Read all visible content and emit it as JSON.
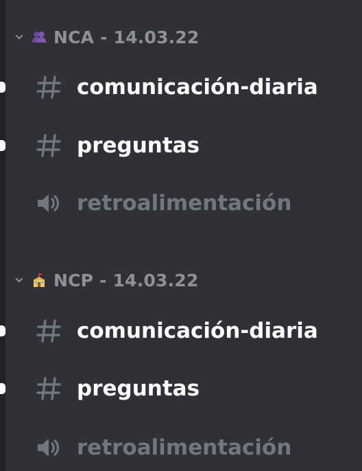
{
  "categories": [
    {
      "name": "NCA - 14.03.22",
      "emoji": "people-icon",
      "channels": [
        {
          "name": "comunicación-diaria",
          "type": "text",
          "unread": true
        },
        {
          "name": "preguntas",
          "type": "text",
          "unread": true
        },
        {
          "name": "retroalimentación",
          "type": "voice",
          "unread": false
        }
      ]
    },
    {
      "name": "NCP - 14.03.22",
      "emoji": "school-icon",
      "channels": [
        {
          "name": "comunicación-diaria",
          "type": "text",
          "unread": true
        },
        {
          "name": "preguntas",
          "type": "text",
          "unread": true
        },
        {
          "name": "retroalimentación",
          "type": "voice",
          "unread": false
        }
      ]
    }
  ],
  "colors": {
    "background": "#2f3136",
    "category_text": "#8e9297",
    "unread_text": "#ffffff",
    "muted_text": "#72767d",
    "icon_gray": "#72767d"
  }
}
